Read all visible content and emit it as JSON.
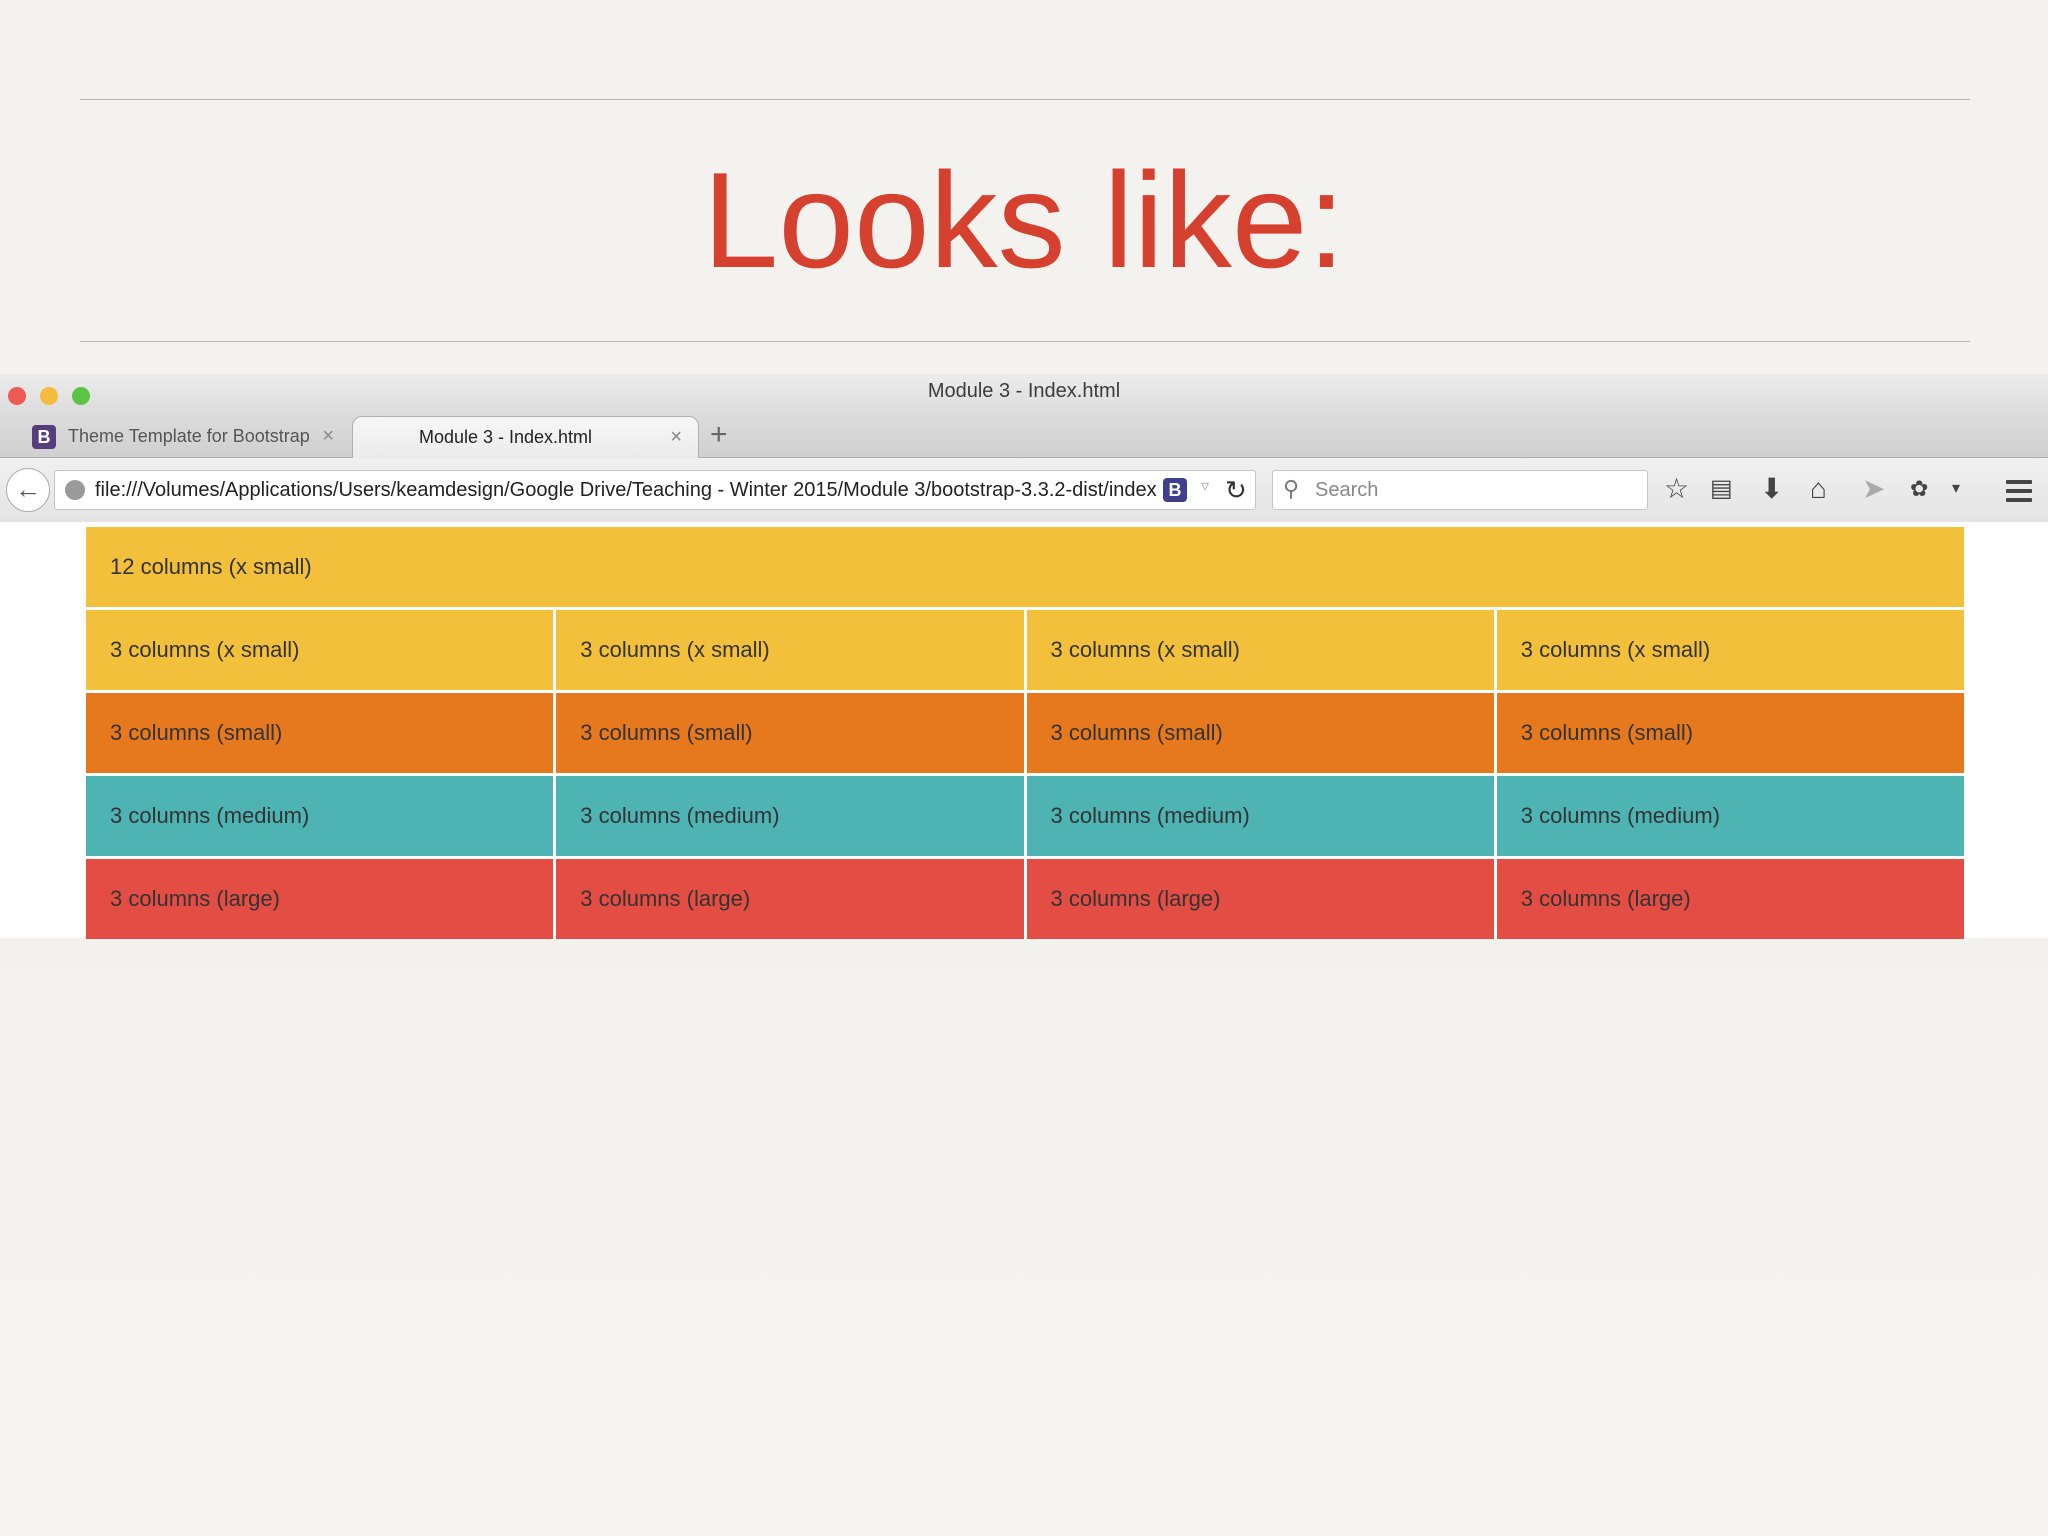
{
  "slide": {
    "title": "Looks like:"
  },
  "browser": {
    "window_title": "Module 3 - Index.html",
    "tabs": [
      {
        "label": "Theme Template for Bootstrap",
        "favicon": "B",
        "active": false
      },
      {
        "label": "Module 3 - Index.html",
        "active": true
      }
    ],
    "close_glyph": "×",
    "new_tab_glyph": "+",
    "url": "file:///Volumes/Applications/Users/keamdesign/Google Drive/Teaching - Winter 2015/Module 3/bootstrap-3.3.2-dist/index",
    "url_badge": "B",
    "search_placeholder": "Search",
    "toolbar_icons": [
      "star-icon",
      "reading-list-icon",
      "download-icon",
      "home-icon",
      "send-icon",
      "extension-icon",
      "menu-icon"
    ]
  },
  "grid": {
    "rows": [
      {
        "color": "#f2c03b",
        "cells": [
          "12 columns (x small)"
        ]
      },
      {
        "color": "#f2c03b",
        "cells": [
          "3 columns (x small)",
          "3 columns (x small)",
          "3 columns (x small)",
          "3 columns (x small)"
        ]
      },
      {
        "color": "#e6781e",
        "cells": [
          "3 columns (small)",
          "3 columns (small)",
          "3 columns (small)",
          "3 columns (small)"
        ]
      },
      {
        "color": "#4db3b3",
        "cells": [
          "3 columns (medium)",
          "3 columns (medium)",
          "3 columns (medium)",
          "3 columns (medium)"
        ]
      },
      {
        "color": "#e34d44",
        "cells": [
          "3 columns (large)",
          "3 columns (large)",
          "3 columns (large)",
          "3 columns (large)"
        ]
      }
    ]
  }
}
